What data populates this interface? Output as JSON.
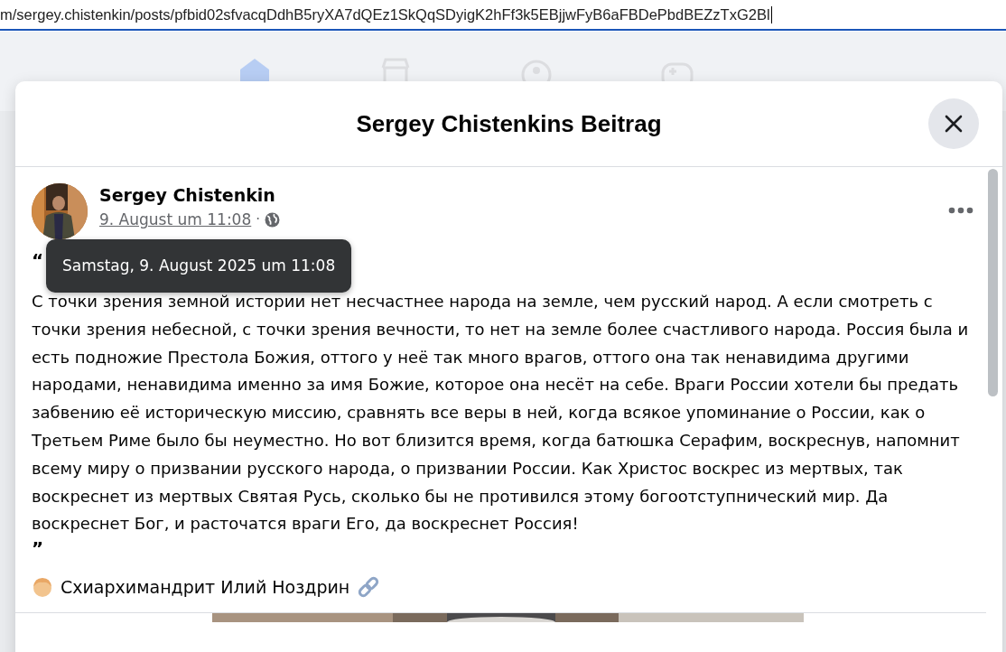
{
  "address_bar": {
    "url": "m/sergey.chistenkin/posts/pfbid02sfvacqDdhB5ryXA7dQEz1SkQqSDyigK2hFf3k5EBjjwFyB6aFBDePbdBEZzTxG2Bl"
  },
  "nav": [
    {
      "kind": "home",
      "selected": true
    },
    {
      "kind": "store",
      "selected": false
    },
    {
      "kind": "groups",
      "selected": false
    },
    {
      "kind": "gaming",
      "selected": false
    }
  ],
  "dialog": {
    "title": "Sergey Chistenkins Beitrag",
    "post": {
      "author": "Sergey Chistenkin",
      "date": "9. August um 11:08",
      "separator": "·",
      "tooltip": "Samstag, 9. August 2025 um 11:08",
      "open_quote": "“",
      "body": "С точки зрения земной истории нет несчастнее народа на земле, чем русский народ. А если смотреть с точки зрения небесной, с точки зрения вечности, то нет на земле более счастливого народа. Россия была и есть подножие Престола Божия, оттого у неё так много врагов, оттого она так ненавидима другими народами, ненавидима именно за имя Божие, которое она несёт на себе. Враги России хотели бы предать забвению её историческую миссию, сравнять все веры в ней, когда всякое упоминание о России, как о Третьем Риме было бы неуместно. Но вот близится время, когда батюшка Серафим, воскреснув, напомнит всему миру о призвании русского народа, о призвании России. Как Христос воскрес из мертвых, так воскреснет из мертвых Святая Русь, сколько бы не противился этому богоотступнический мир. Да воскреснет Бог, и расточатся враги Его, да воскреснет Россия!",
      "close_quote": "”",
      "attribution": "Схиархимандрит Илий Ноздрин"
    }
  }
}
